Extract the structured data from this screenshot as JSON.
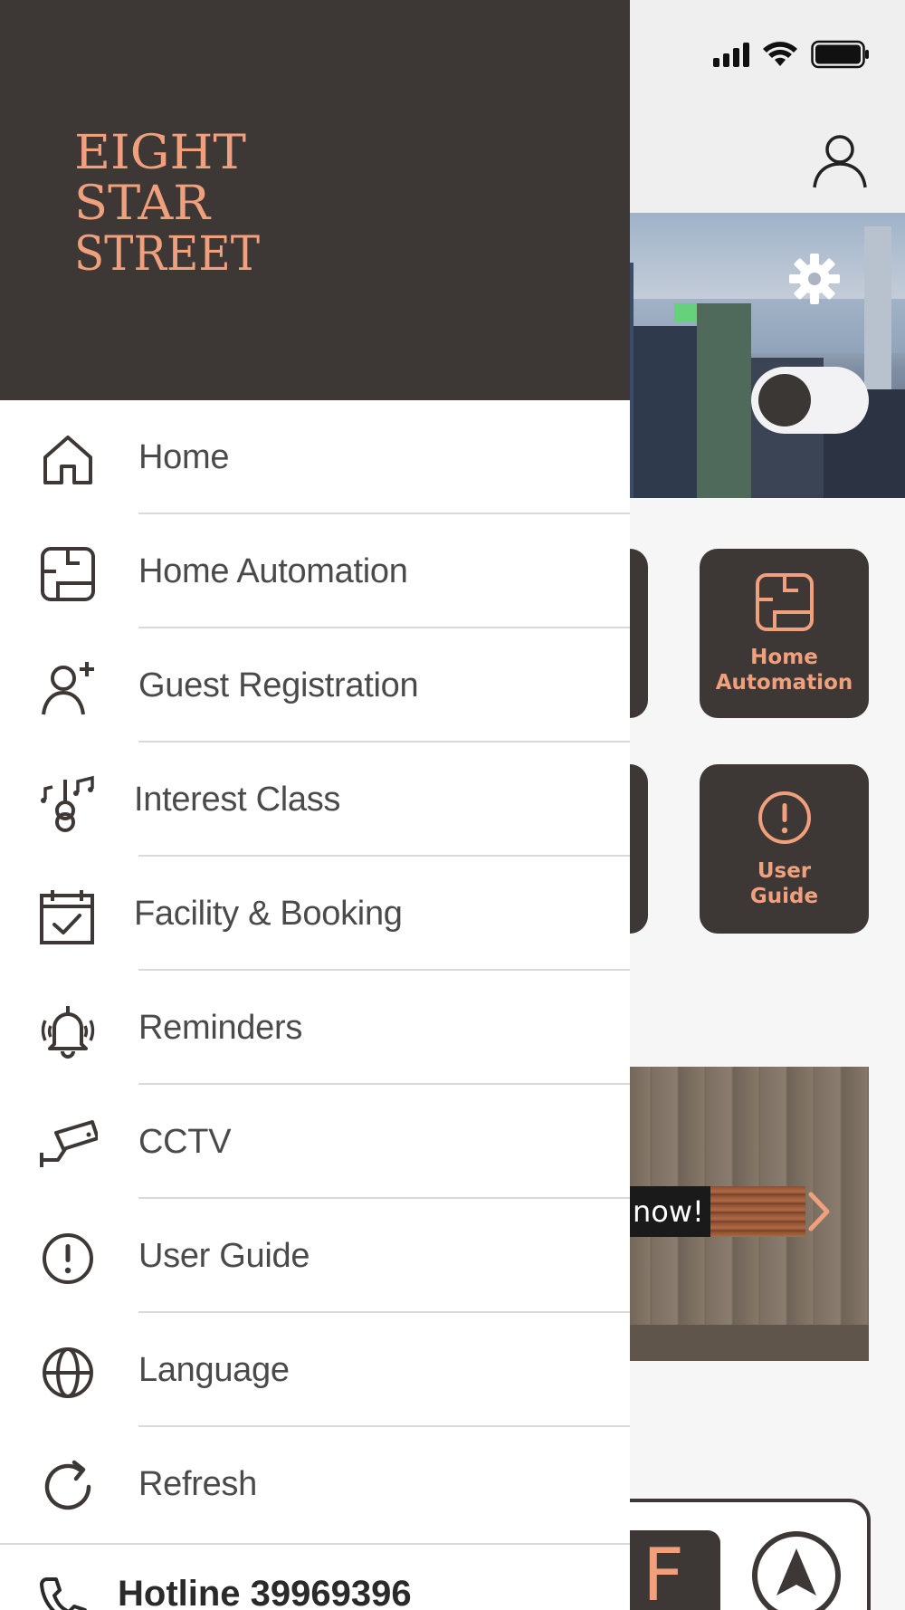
{
  "colors": {
    "drawer_header_bg": "#3d3835",
    "accent": "#f0a07c",
    "menu_text": "#4a4a4a",
    "divider": "#d9d9d9"
  },
  "logo": {
    "line1": "EIGHT",
    "line2": "STAR",
    "line3": "STREET"
  },
  "menu": {
    "items": [
      {
        "label": "Home",
        "icon": "home-icon"
      },
      {
        "label": "Home Automation",
        "icon": "floorplan-icon"
      },
      {
        "label": "Guest Registration",
        "icon": "add-user-icon"
      },
      {
        "label": "Interest Class",
        "icon": "guitar-music-icon"
      },
      {
        "label": "Facility & Booking",
        "icon": "calendar-check-icon"
      },
      {
        "label": "Reminders",
        "icon": "bell-ringing-icon"
      },
      {
        "label": "CCTV",
        "icon": "cctv-camera-icon"
      },
      {
        "label": "User Guide",
        "icon": "exclamation-circle-icon"
      },
      {
        "label": "Language",
        "icon": "globe-icon"
      },
      {
        "label": "Refresh",
        "icon": "refresh-icon"
      }
    ]
  },
  "hotline": {
    "label": "Hotline 39969396",
    "icon": "phone-icon"
  },
  "background": {
    "tiles": [
      {
        "label_line1": "Home",
        "label_line2": "Automation",
        "icon": "floorplan-icon"
      },
      {
        "label_line1": "User",
        "label_line2": "Guide",
        "icon": "exclamation-circle-icon"
      }
    ],
    "banner_cta": "now!",
    "bottom_letter": "F"
  }
}
